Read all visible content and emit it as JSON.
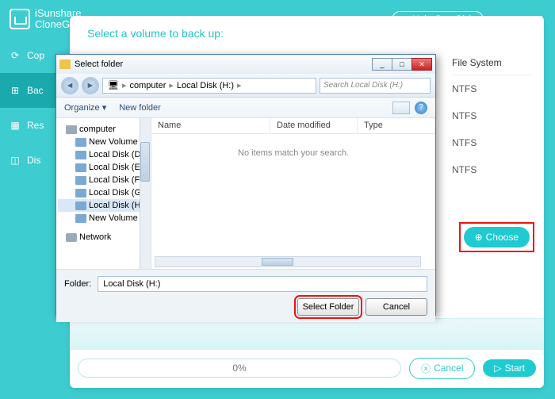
{
  "app": {
    "name_line1": "iSunshare",
    "name_line2": "CloneGo",
    "boot_label": "Make Boot Disk"
  },
  "sidebar": {
    "items": [
      {
        "label": "Cop"
      },
      {
        "label": "Bac"
      },
      {
        "label": "Res"
      },
      {
        "label": "Dis"
      }
    ]
  },
  "main": {
    "header": "Select a volume to back up:",
    "fs_header": "File System",
    "fs_rows": [
      "NTFS",
      "NTFS",
      "NTFS",
      "NTFS"
    ],
    "choose_label": "Choose",
    "progress_text": "0%",
    "cancel_label": "Cancel",
    "start_label": "Start"
  },
  "dialog": {
    "title": "Select folder",
    "breadcrumb": {
      "root_icon": "computer",
      "parts": [
        "computer",
        "Local Disk (H:)"
      ]
    },
    "search_placeholder": "Search Local Disk (H:)",
    "toolbar": {
      "organize": "Organize ▾",
      "newfolder": "New folder"
    },
    "columns": [
      "Name",
      "Date modified",
      "Type"
    ],
    "empty_msg": "No items match your search.",
    "tree": {
      "root": "computer",
      "drives": [
        "New Volume (C:",
        "Local Disk (D:)",
        "Local Disk (E:)",
        "Local Disk (F:)",
        "Local Disk (G:)",
        "Local Disk (H:)",
        "New Volume (I:)"
      ],
      "network": "Network"
    },
    "folder_label": "Folder:",
    "folder_value": "Local Disk (H:)",
    "select_btn": "Select Folder",
    "cancel_btn": "Cancel"
  }
}
